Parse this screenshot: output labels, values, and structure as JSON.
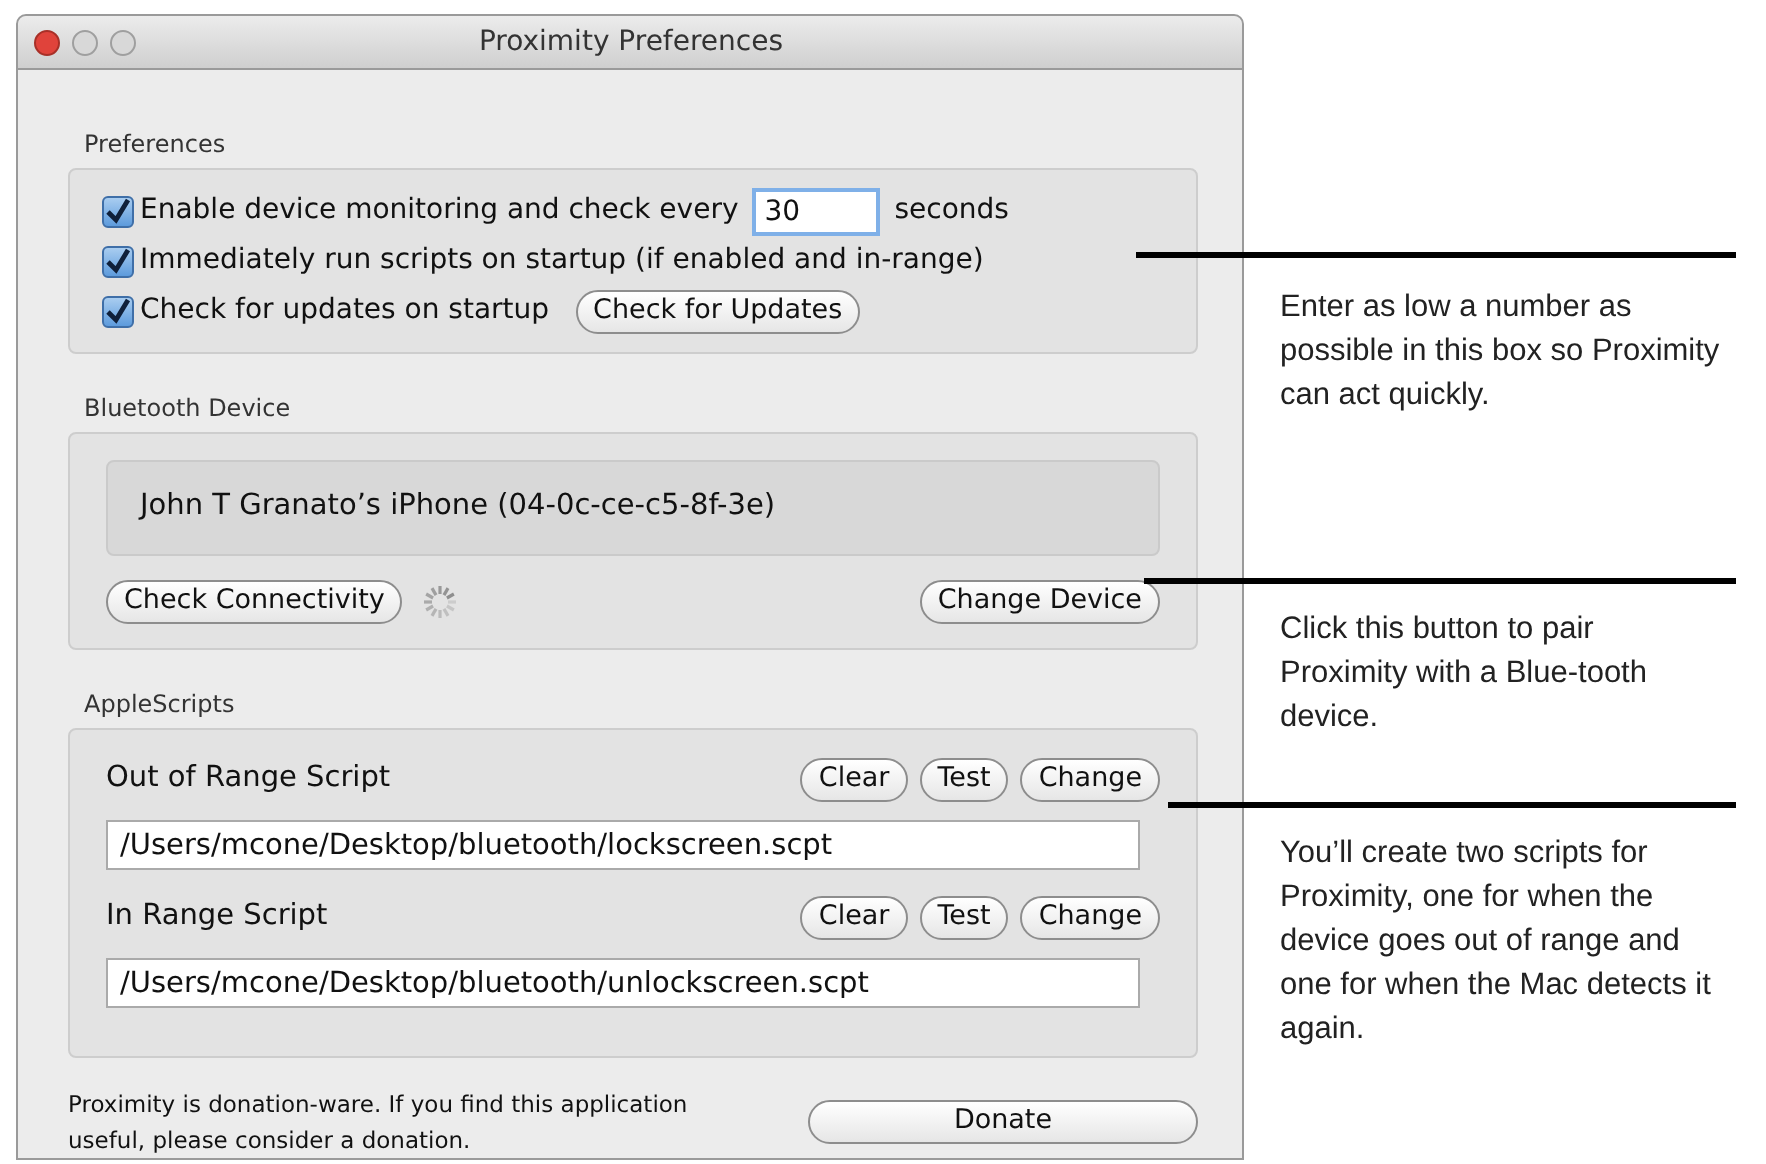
{
  "window": {
    "title": "Proximity Preferences"
  },
  "preferences": {
    "label": "Preferences",
    "options": [
      {
        "label": "Enable device monitoring and check every",
        "checked": true,
        "field_value": "30",
        "suffix": "seconds"
      },
      {
        "label": "Immediately run scripts on startup (if enabled and in-range)",
        "checked": true
      },
      {
        "label": "Check for updates on startup",
        "checked": true,
        "button": "Check for Updates"
      }
    ]
  },
  "bluetooth_device": {
    "label": "Bluetooth Device",
    "device": "John T Granato’s iPhone (04-0c-ce-c5-8f-3e)",
    "buttons": [
      "Check Connectivity",
      "Change Device"
    ]
  },
  "applescripts": {
    "label": "AppleScripts",
    "scripts": [
      {
        "label": "Out of Range Script",
        "buttons": [
          "Clear",
          "Test",
          "Change"
        ],
        "path": "/Users/mcone/Desktop/bluetooth/lockscreen.scpt"
      },
      {
        "label": "In Range Script",
        "buttons": [
          "Clear",
          "Test",
          "Change"
        ],
        "path": "/Users/mcone/Desktop/bluetooth/unlockscreen.scpt"
      }
    ]
  },
  "footer": {
    "note": "Proximity is donation-ware. If you find this application useful, please consider a donation.",
    "button": "Donate"
  },
  "callouts": [
    {
      "text": "Enter as low a number as possible in this box so Proximity can act quickly."
    },
    {
      "text": "Click this button to pair Proximity with a Blue-tooth device."
    },
    {
      "text": "You’ll create two scripts for Proximity, one for when the device goes out of range and one for when the Mac detects it again."
    }
  ]
}
